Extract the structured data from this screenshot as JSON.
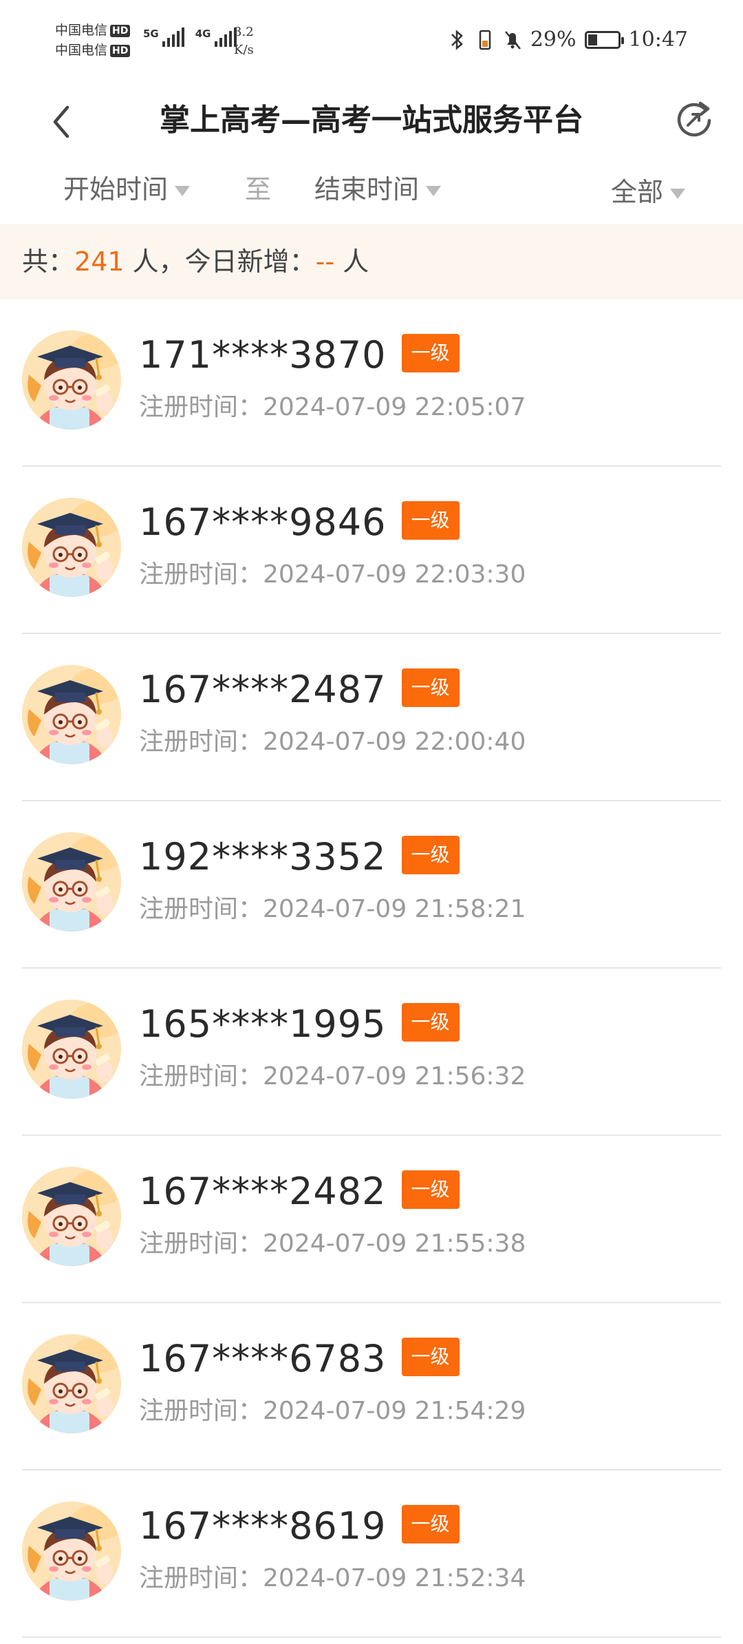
{
  "status_bar": {
    "carrier_1": "中国电信",
    "carrier_2": "中国电信",
    "hd_badge": "HD",
    "net_1": "5G",
    "net_2": "4G",
    "speed_value": "3.2",
    "speed_unit": "K/s",
    "battery_percent": "29%",
    "battery_level": 0.29,
    "time": "10:47",
    "icons": [
      "bluetooth-icon",
      "vibrate-icon",
      "mute-icon",
      "battery-charging-icon"
    ]
  },
  "navbar": {
    "title": "掌上高考—高考一站式服务平台",
    "back_icon": "chevron-left-icon",
    "refresh_icon": "refresh-icon"
  },
  "filters": {
    "start_time": "开始时间",
    "separator": "至",
    "end_time": "结束时间",
    "scope": "全部"
  },
  "summary": {
    "prefix": "共：",
    "total": "241",
    "middle": " 人，今日新增：",
    "today": "--",
    "suffix": " 人"
  },
  "accent_color": "#fb6a0b",
  "users": [
    {
      "phone": "171****3870",
      "level": "一级",
      "reg_label": "注册时间：",
      "reg_time": "2024-07-09 22:05:07"
    },
    {
      "phone": "167****9846",
      "level": "一级",
      "reg_label": "注册时间：",
      "reg_time": "2024-07-09 22:03:30"
    },
    {
      "phone": "167****2487",
      "level": "一级",
      "reg_label": "注册时间：",
      "reg_time": "2024-07-09 22:00:40"
    },
    {
      "phone": "192****3352",
      "level": "一级",
      "reg_label": "注册时间：",
      "reg_time": "2024-07-09 21:58:21"
    },
    {
      "phone": "165****1995",
      "level": "一级",
      "reg_label": "注册时间：",
      "reg_time": "2024-07-09 21:56:32"
    },
    {
      "phone": "167****2482",
      "level": "一级",
      "reg_label": "注册时间：",
      "reg_time": "2024-07-09 21:55:38"
    },
    {
      "phone": "167****6783",
      "level": "一级",
      "reg_label": "注册时间：",
      "reg_time": "2024-07-09 21:54:29"
    },
    {
      "phone": "167****8619",
      "level": "一级",
      "reg_label": "注册时间：",
      "reg_time": "2024-07-09 21:52:34"
    }
  ]
}
